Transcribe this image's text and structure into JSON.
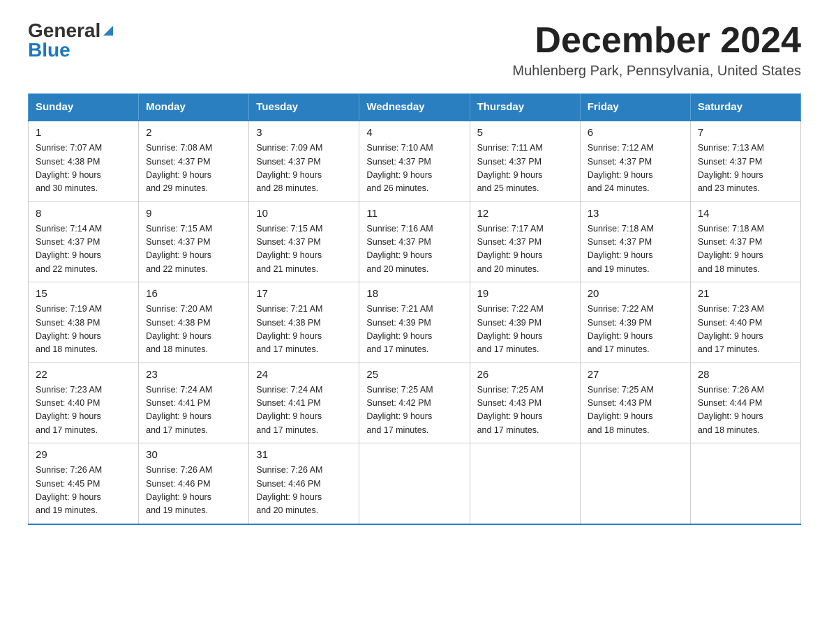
{
  "header": {
    "logo_general": "General",
    "logo_blue": "Blue",
    "month_title": "December 2024",
    "location": "Muhlenberg Park, Pennsylvania, United States"
  },
  "days_of_week": [
    "Sunday",
    "Monday",
    "Tuesday",
    "Wednesday",
    "Thursday",
    "Friday",
    "Saturday"
  ],
  "weeks": [
    [
      {
        "day": "1",
        "sunrise": "7:07 AM",
        "sunset": "4:38 PM",
        "daylight": "9 hours and 30 minutes."
      },
      {
        "day": "2",
        "sunrise": "7:08 AM",
        "sunset": "4:37 PM",
        "daylight": "9 hours and 29 minutes."
      },
      {
        "day": "3",
        "sunrise": "7:09 AM",
        "sunset": "4:37 PM",
        "daylight": "9 hours and 28 minutes."
      },
      {
        "day": "4",
        "sunrise": "7:10 AM",
        "sunset": "4:37 PM",
        "daylight": "9 hours and 26 minutes."
      },
      {
        "day": "5",
        "sunrise": "7:11 AM",
        "sunset": "4:37 PM",
        "daylight": "9 hours and 25 minutes."
      },
      {
        "day": "6",
        "sunrise": "7:12 AM",
        "sunset": "4:37 PM",
        "daylight": "9 hours and 24 minutes."
      },
      {
        "day": "7",
        "sunrise": "7:13 AM",
        "sunset": "4:37 PM",
        "daylight": "9 hours and 23 minutes."
      }
    ],
    [
      {
        "day": "8",
        "sunrise": "7:14 AM",
        "sunset": "4:37 PM",
        "daylight": "9 hours and 22 minutes."
      },
      {
        "day": "9",
        "sunrise": "7:15 AM",
        "sunset": "4:37 PM",
        "daylight": "9 hours and 22 minutes."
      },
      {
        "day": "10",
        "sunrise": "7:15 AM",
        "sunset": "4:37 PM",
        "daylight": "9 hours and 21 minutes."
      },
      {
        "day": "11",
        "sunrise": "7:16 AM",
        "sunset": "4:37 PM",
        "daylight": "9 hours and 20 minutes."
      },
      {
        "day": "12",
        "sunrise": "7:17 AM",
        "sunset": "4:37 PM",
        "daylight": "9 hours and 20 minutes."
      },
      {
        "day": "13",
        "sunrise": "7:18 AM",
        "sunset": "4:37 PM",
        "daylight": "9 hours and 19 minutes."
      },
      {
        "day": "14",
        "sunrise": "7:18 AM",
        "sunset": "4:37 PM",
        "daylight": "9 hours and 18 minutes."
      }
    ],
    [
      {
        "day": "15",
        "sunrise": "7:19 AM",
        "sunset": "4:38 PM",
        "daylight": "9 hours and 18 minutes."
      },
      {
        "day": "16",
        "sunrise": "7:20 AM",
        "sunset": "4:38 PM",
        "daylight": "9 hours and 18 minutes."
      },
      {
        "day": "17",
        "sunrise": "7:21 AM",
        "sunset": "4:38 PM",
        "daylight": "9 hours and 17 minutes."
      },
      {
        "day": "18",
        "sunrise": "7:21 AM",
        "sunset": "4:39 PM",
        "daylight": "9 hours and 17 minutes."
      },
      {
        "day": "19",
        "sunrise": "7:22 AM",
        "sunset": "4:39 PM",
        "daylight": "9 hours and 17 minutes."
      },
      {
        "day": "20",
        "sunrise": "7:22 AM",
        "sunset": "4:39 PM",
        "daylight": "9 hours and 17 minutes."
      },
      {
        "day": "21",
        "sunrise": "7:23 AM",
        "sunset": "4:40 PM",
        "daylight": "9 hours and 17 minutes."
      }
    ],
    [
      {
        "day": "22",
        "sunrise": "7:23 AM",
        "sunset": "4:40 PM",
        "daylight": "9 hours and 17 minutes."
      },
      {
        "day": "23",
        "sunrise": "7:24 AM",
        "sunset": "4:41 PM",
        "daylight": "9 hours and 17 minutes."
      },
      {
        "day": "24",
        "sunrise": "7:24 AM",
        "sunset": "4:41 PM",
        "daylight": "9 hours and 17 minutes."
      },
      {
        "day": "25",
        "sunrise": "7:25 AM",
        "sunset": "4:42 PM",
        "daylight": "9 hours and 17 minutes."
      },
      {
        "day": "26",
        "sunrise": "7:25 AM",
        "sunset": "4:43 PM",
        "daylight": "9 hours and 17 minutes."
      },
      {
        "day": "27",
        "sunrise": "7:25 AM",
        "sunset": "4:43 PM",
        "daylight": "9 hours and 18 minutes."
      },
      {
        "day": "28",
        "sunrise": "7:26 AM",
        "sunset": "4:44 PM",
        "daylight": "9 hours and 18 minutes."
      }
    ],
    [
      {
        "day": "29",
        "sunrise": "7:26 AM",
        "sunset": "4:45 PM",
        "daylight": "9 hours and 19 minutes."
      },
      {
        "day": "30",
        "sunrise": "7:26 AM",
        "sunset": "4:46 PM",
        "daylight": "9 hours and 19 minutes."
      },
      {
        "day": "31",
        "sunrise": "7:26 AM",
        "sunset": "4:46 PM",
        "daylight": "9 hours and 20 minutes."
      },
      null,
      null,
      null,
      null
    ]
  ],
  "labels": {
    "sunrise": "Sunrise:",
    "sunset": "Sunset:",
    "daylight": "Daylight:"
  },
  "colors": {
    "header_bg": "#2a7fc1",
    "header_text": "#ffffff",
    "accent": "#1a78c2"
  }
}
